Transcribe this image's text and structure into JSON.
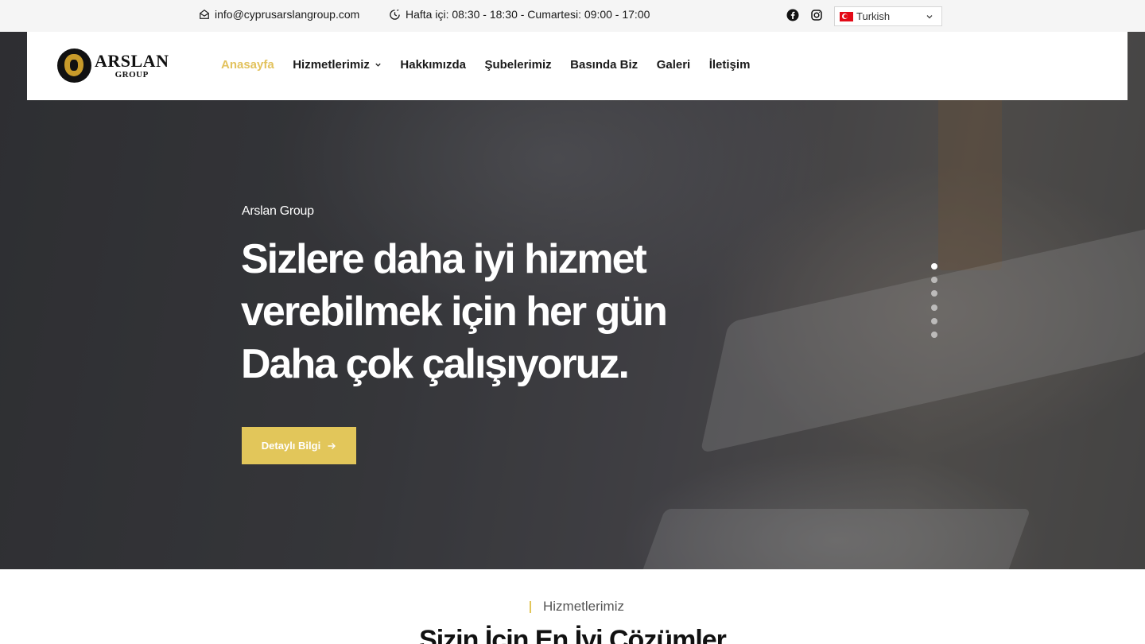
{
  "topbar": {
    "email": "info@cyprusarslangroup.com",
    "hours": "Hafta içi: 08:30 - 18:30 - Cumartesi: 09:00 - 17:00",
    "language": "Turkish",
    "icons": [
      "mail-icon",
      "clock-icon",
      "facebook-icon",
      "instagram-icon",
      "turkey-flag-icon",
      "chevron-down-icon"
    ]
  },
  "logo": {
    "main": "ARSLAN",
    "sub": "GROUP"
  },
  "nav": {
    "items": [
      {
        "label": "Anasayfa",
        "active": true
      },
      {
        "label": "Hizmetlerimiz",
        "dropdown": true
      },
      {
        "label": "Hakkımızda"
      },
      {
        "label": "Şubelerimiz"
      },
      {
        "label": "Basında Biz"
      },
      {
        "label": "Galeri"
      },
      {
        "label": "İletişim"
      }
    ]
  },
  "hero": {
    "kicker": "Arslan Group",
    "title_line1": "Sizlere daha iyi hizmet",
    "title_line2": "verebilmek için her gün",
    "title_line3": "Daha çok çalışıyoruz.",
    "button_label": "Detaylı Bilgi",
    "slides": 6,
    "active_slide": 1
  },
  "services": {
    "kicker": "Hizmetlerimiz",
    "title": "Sizin İçin En İyi Çözümler"
  },
  "colors": {
    "accent": "#e2c65a",
    "nav_active": "#e2c25d",
    "topbar_bg": "#f5f5f5"
  }
}
